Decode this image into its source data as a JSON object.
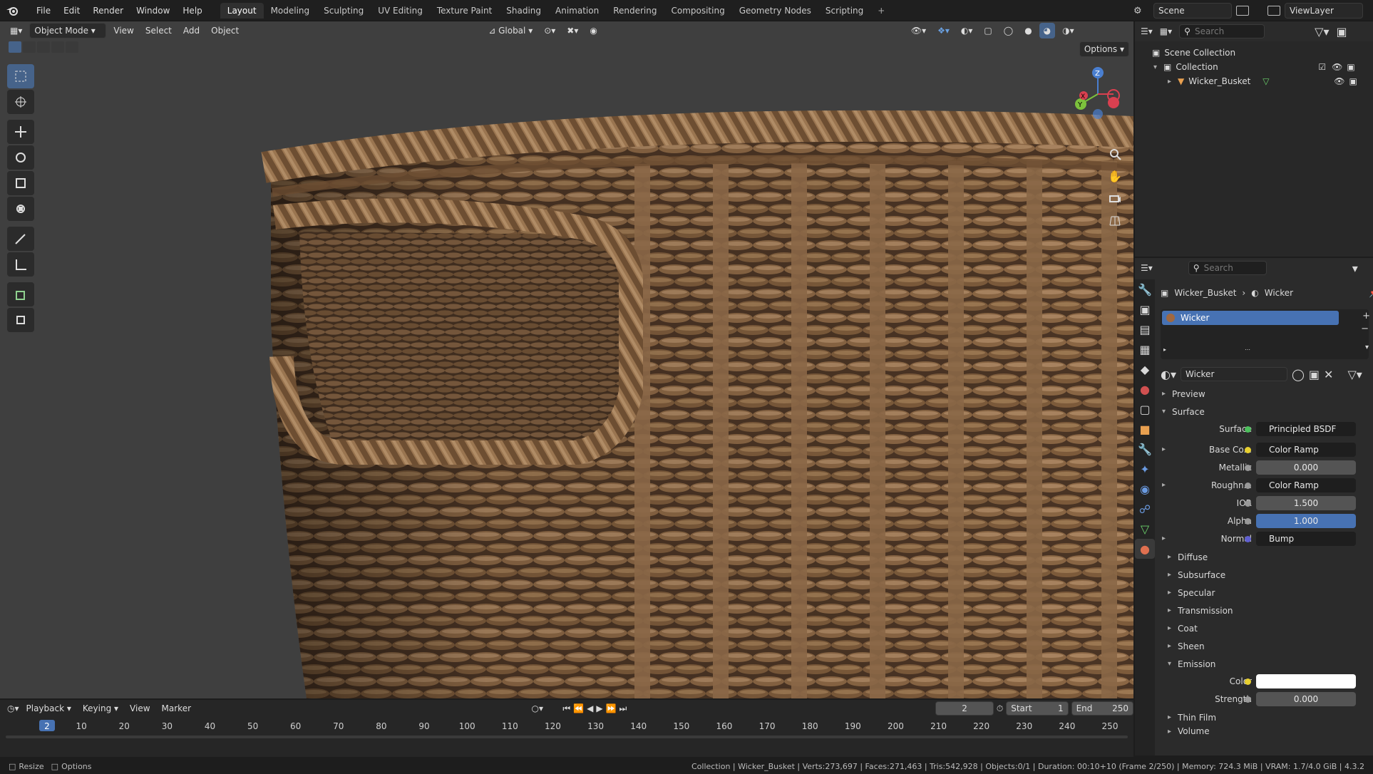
{
  "topbar": {
    "menus": [
      "File",
      "Edit",
      "Render",
      "Window",
      "Help"
    ],
    "tabs": [
      "Layout",
      "Modeling",
      "Sculpting",
      "UV Editing",
      "Texture Paint",
      "Shading",
      "Animation",
      "Rendering",
      "Compositing",
      "Geometry Nodes",
      "Scripting"
    ],
    "active_tab": "Layout",
    "plus": "+",
    "scene": "Scene",
    "view_layer": "ViewLayer"
  },
  "viewport": {
    "mode": "Object Mode",
    "menus": [
      "View",
      "Select",
      "Add",
      "Object"
    ],
    "orientation": "Global",
    "options": "Options",
    "gizmo": {
      "x": "X",
      "y": "Y",
      "z": "Z"
    },
    "colors": {
      "bg": "#3f3f3f",
      "wicker": "#7a5a3c",
      "active": "#46638a"
    }
  },
  "outliner": {
    "search_placeholder": "Search",
    "scene_collection": "Scene Collection",
    "collection": "Collection",
    "object": "Wicker_Busket"
  },
  "properties": {
    "search_placeholder": "Search",
    "breadcrumb_object": "Wicker_Busket",
    "breadcrumb_material": "Wicker",
    "slot": "Wicker",
    "material_name": "Wicker",
    "sections": {
      "preview": "Preview",
      "surface": "Surface"
    },
    "surface_label": "Surface",
    "surface_value": "Principled BSDF",
    "rows": [
      {
        "label": "Base Co...",
        "value": "Color Ramp"
      },
      {
        "label": "Metallic",
        "value": "0.000"
      },
      {
        "label": "Roughn...",
        "value": "Color Ramp"
      },
      {
        "label": "IOR",
        "value": "1.500"
      },
      {
        "label": "Alpha",
        "value": "1.000"
      },
      {
        "label": "Normal",
        "value": "Bump"
      }
    ],
    "subsections": [
      "Diffuse",
      "Subsurface",
      "Specular",
      "Transmission",
      "Coat",
      "Sheen"
    ],
    "emission": "Emission",
    "emission_color_label": "Color",
    "emission_strength_label": "Strength",
    "emission_strength": "0.000",
    "thin_film": "Thin Film",
    "volume": "Volume"
  },
  "timeline": {
    "menus": [
      "Playback",
      "Keying",
      "View",
      "Marker"
    ],
    "current_frame": "2",
    "start_label": "Start",
    "start": "1",
    "end_label": "End",
    "end": "250",
    "ticks": [
      "2",
      "10",
      "20",
      "30",
      "40",
      "50",
      "60",
      "70",
      "80",
      "90",
      "100",
      "110",
      "120",
      "130",
      "140",
      "150",
      "160",
      "170",
      "180",
      "190",
      "200",
      "210",
      "220",
      "230",
      "240",
      "250"
    ]
  },
  "status": {
    "left1": "Resize",
    "left2": "Options",
    "right": "Collection | Wicker_Busket | Verts:273,697 | Faces:271,463 | Tris:542,928 | Objects:0/1 | Duration: 00:10+10 (Frame 2/250) | Memory: 724.3 MiB | VRAM: 1.7/4.0 GiB | 4.3.2"
  }
}
